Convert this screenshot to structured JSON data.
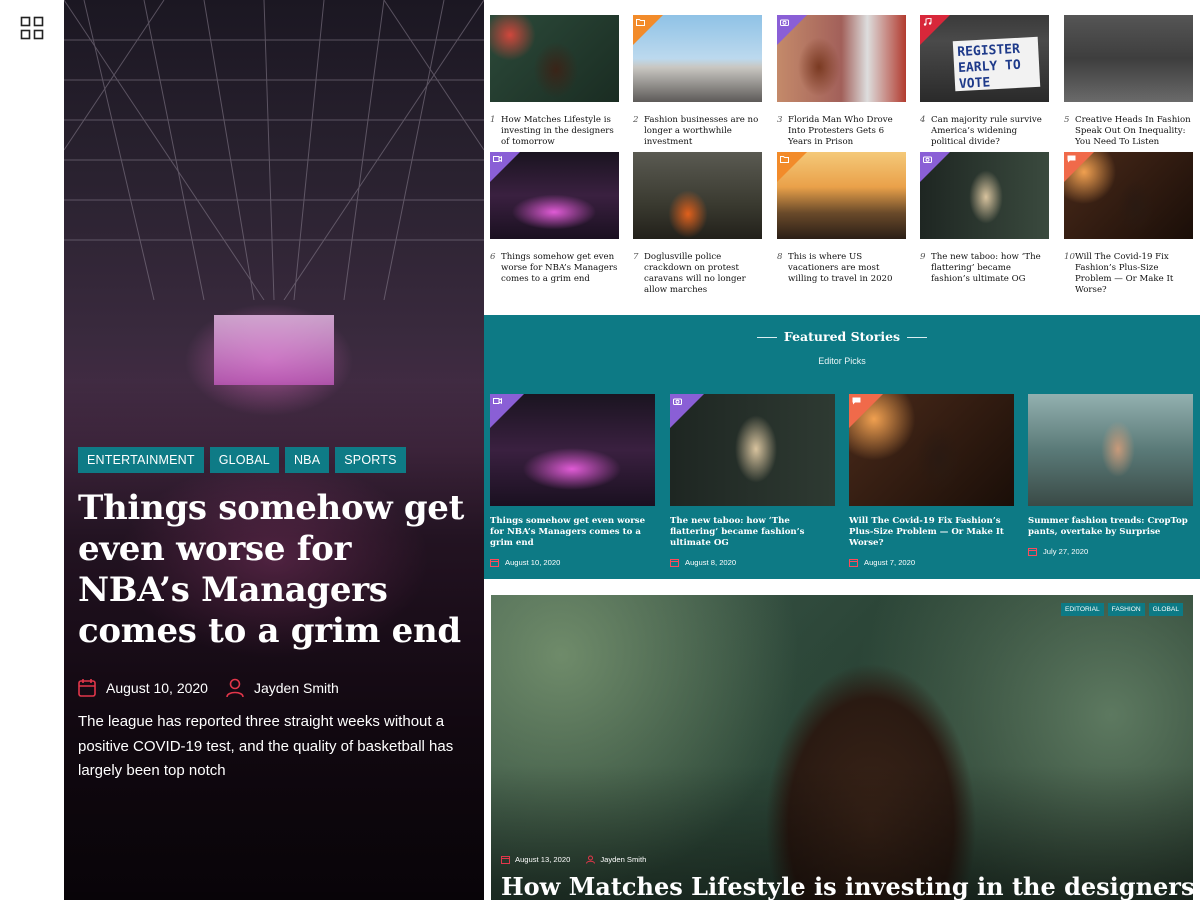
{
  "colors": {
    "accent": "#0d7a85",
    "badge_orange": "#f28b2a",
    "badge_purple": "#8a5fd6",
    "badge_red": "#d8273a",
    "badge_salmon": "#f06a4a"
  },
  "menu_icon": "grid-icon",
  "hero": {
    "tags": [
      "ENTERTAINMENT",
      "GLOBAL",
      "NBA",
      "SPORTS"
    ],
    "title": "Things somehow get even worse for NBA’s Managers comes to a grim end",
    "date": "August 10, 2020",
    "author": "Jayden Smith",
    "excerpt": "The league has reported three straight weeks without a positive COVID-19 test, and the quality of basketball has largely been top notch"
  },
  "mini_posts": [
    {
      "num": "1",
      "title": "How Matches Lifestyle is investing in the designers of tomorrow",
      "badge": null,
      "badge_icon": null
    },
    {
      "num": "2",
      "title": "Fashion businesses are no longer a worthwhile investment",
      "badge": "orange",
      "badge_icon": "folder-icon"
    },
    {
      "num": "3",
      "title": "Florida Man Who Drove Into Protesters Gets 6 Years in Prison",
      "badge": "purple",
      "badge_icon": "camera-icon"
    },
    {
      "num": "4",
      "title": "Can majority rule survive America’s widening political divide?",
      "badge": "red",
      "badge_icon": "music-icon"
    },
    {
      "num": "5",
      "title": "Creative Heads In Fashion Speak Out On Inequality: You Need To Listen",
      "badge": null,
      "badge_icon": null
    },
    {
      "num": "6",
      "title": "Things somehow get even worse for NBA’s Managers comes to a grim end",
      "badge": "purple",
      "badge_icon": "video-icon"
    },
    {
      "num": "7",
      "title": "Doglusville police crackdown on protest caravans will no longer allow marches",
      "badge": null,
      "badge_icon": null
    },
    {
      "num": "8",
      "title": "This is where US vacationers are most willing to travel in 2020",
      "badge": "orange",
      "badge_icon": "folder-icon"
    },
    {
      "num": "9",
      "title": "The new taboo: how ‘The flattering’ became fashion’s ultimate OG",
      "badge": "purple",
      "badge_icon": "camera-icon"
    },
    {
      "num": "10",
      "title": "Will The Covid-19 Fix Fashion’s Plus-Size Problem — Or Make It Worse?",
      "badge": "salmon",
      "badge_icon": "comment-icon"
    }
  ],
  "featured": {
    "title": "Featured Stories",
    "subtitle": "Editor Picks",
    "cards": [
      {
        "title": "Things somehow get even worse for NBA’s Managers comes to a grim end",
        "date": "August 10, 2020",
        "badge": "purple",
        "badge_icon": "video-icon"
      },
      {
        "title": "The new taboo: how ‘The flattering’ became fashion’s ultimate OG",
        "date": "August 8, 2020",
        "badge": "purple",
        "badge_icon": "camera-icon"
      },
      {
        "title": "Will The Covid-19 Fix Fashion’s Plus-Size Problem — Or Make It Worse?",
        "date": "August 7, 2020",
        "badge": "salmon",
        "badge_icon": "comment-icon"
      },
      {
        "title": "Summer fashion trends: CropTop pants, overtake by Surprise",
        "date": "July 27, 2020",
        "badge": null,
        "badge_icon": null
      }
    ]
  },
  "big_post": {
    "tags": [
      "EDITORIAL",
      "FASHION",
      "GLOBAL"
    ],
    "date": "August 13, 2020",
    "author": "Jayden Smith",
    "title": "How Matches Lifestyle is investing in the designers"
  }
}
